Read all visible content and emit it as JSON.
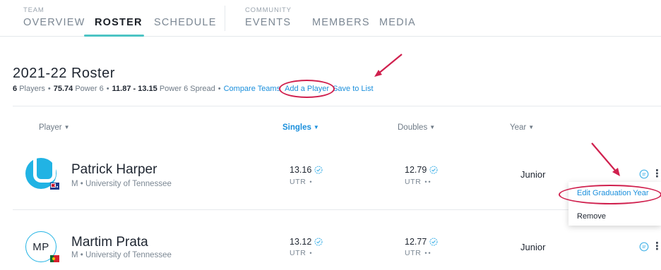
{
  "nav": {
    "team_label": "TEAM",
    "community_label": "COMMUNITY",
    "tabs": [
      {
        "label": "OVERVIEW"
      },
      {
        "label": "ROSTER"
      },
      {
        "label": "SCHEDULE"
      },
      {
        "label": "EVENTS"
      },
      {
        "label": "MEMBERS"
      },
      {
        "label": "MEDIA"
      }
    ],
    "active_tab": "ROSTER"
  },
  "roster": {
    "title": "2021-22 Roster",
    "players_count": "6",
    "players_text": "Players",
    "power6": "75.74",
    "power6_text": "Power 6",
    "spread": "11.87 - 13.15",
    "spread_text": "Power 6 Spread",
    "bullet": "•",
    "compare_link": "Compare Teams",
    "add_link": "Add a Player",
    "save_link": "Save to List"
  },
  "table": {
    "headers": [
      "Player",
      "Singles",
      "Doubles",
      "Year"
    ],
    "sorted_column": "Singles",
    "rows": [
      {
        "name": "Patrick Harper",
        "subtitle": "M • University of Tennessee",
        "singles": "13.16",
        "singles_label": "UTR",
        "singles_dots": "•",
        "doubles": "12.79",
        "doubles_label": "UTR",
        "doubles_dots": "••",
        "year": "Junior",
        "avatar": "utr-logo",
        "flag": "australia-flag"
      },
      {
        "name": "Martim Prata",
        "subtitle": "M • University of Tennessee",
        "initials": "MP",
        "singles": "13.12",
        "singles_label": "UTR",
        "singles_dots": "•",
        "doubles": "12.77",
        "doubles_label": "UTR",
        "doubles_dots": "••",
        "year": "Junior",
        "avatar": "initials",
        "flag": "portugal-flag"
      }
    ]
  },
  "menu": {
    "items": [
      {
        "label": "Edit Graduation Year"
      },
      {
        "label": "Remove"
      }
    ]
  },
  "colors": {
    "accent": "#1a8fdc",
    "annotation": "#d0204e",
    "tab_underline": "#4cc4c4",
    "avatar_blue": "#21b3e4"
  }
}
